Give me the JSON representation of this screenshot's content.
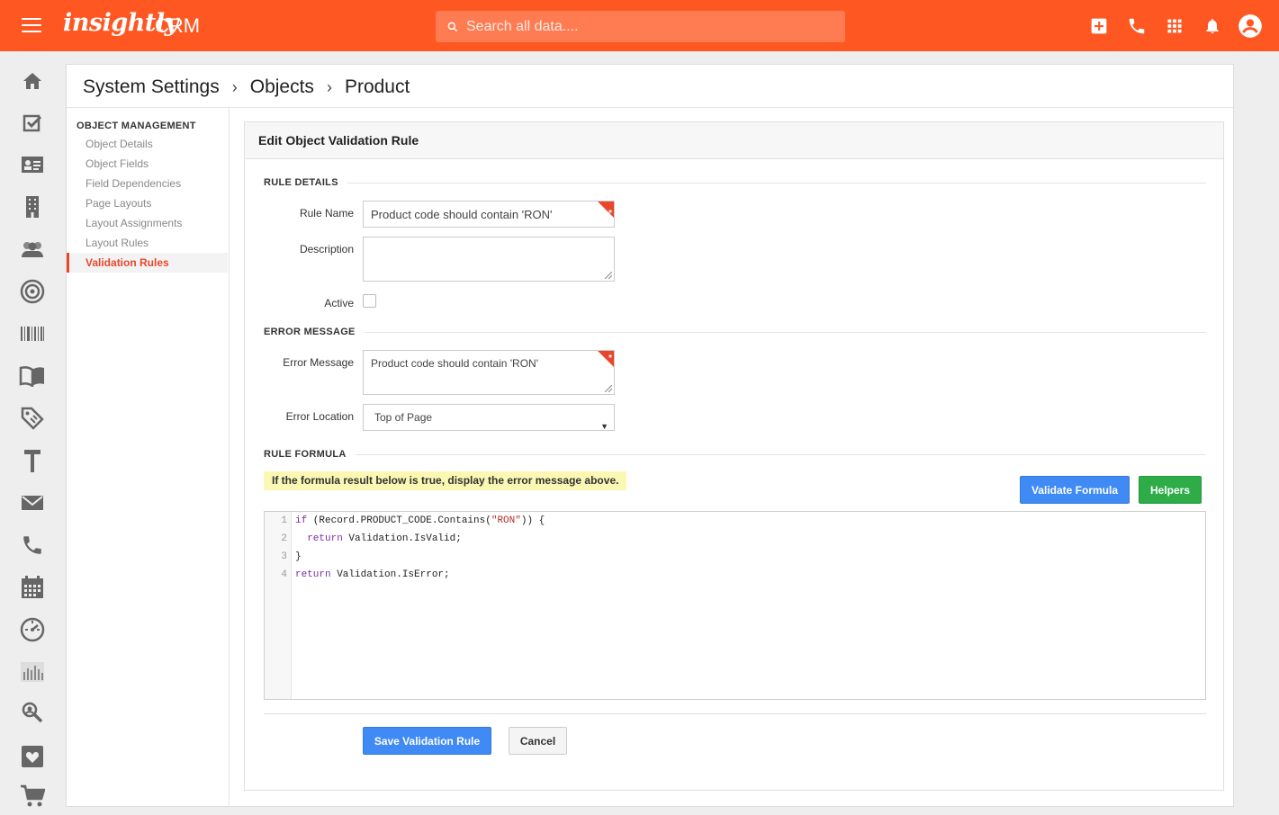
{
  "topbar": {
    "brand": "insightly",
    "brand_suffix": "CRM",
    "search_placeholder": "Search all data....",
    "icons": [
      "add-icon",
      "phone-icon",
      "apps-icon",
      "bell-icon",
      "account-icon"
    ]
  },
  "leftnav": {
    "icons": [
      "home-icon",
      "tasks-icon",
      "contacts-icon",
      "organizations-icon",
      "leads-icon",
      "opportunities-icon",
      "products-icon",
      "knowledge-icon",
      "tags-icon",
      "projects-icon",
      "email-icon",
      "calls-icon",
      "calendar-icon",
      "dashboard-icon",
      "reports-icon",
      "search-people-icon",
      "favorites-icon",
      "cart-icon"
    ]
  },
  "breadcrumb": [
    "System Settings",
    "Objects",
    "Product"
  ],
  "subnav": {
    "heading": "OBJECT MANAGEMENT",
    "items": [
      "Object Details",
      "Object Fields",
      "Field Dependencies",
      "Page Layouts",
      "Layout Assignments",
      "Layout Rules",
      "Validation Rules"
    ],
    "active_index": 6
  },
  "card": {
    "title": "Edit Object Validation Rule",
    "rule_details": {
      "section": "RULE DETAILS",
      "rule_name_label": "Rule Name",
      "rule_name_value": "Product code should contain 'RON'",
      "description_label": "Description",
      "description_value": "",
      "active_label": "Active",
      "active_checked": false
    },
    "error_message": {
      "section": "ERROR MESSAGE",
      "error_message_label": "Error Message",
      "error_message_value": "Product code should contain 'RON'",
      "error_location_label": "Error Location",
      "error_location_value": "Top of Page"
    },
    "rule_formula": {
      "section": "RULE FORMULA",
      "hint": "If the formula result below is true, display the error message above.",
      "validate_label": "Validate Formula",
      "helpers_label": "Helpers",
      "line_numbers": [
        "1",
        "2",
        "3",
        "4"
      ],
      "code": {
        "l1_kw": "if",
        "l1_a": " (Record.PRODUCT_CODE.Contains(",
        "l1_str": "\"RON\"",
        "l1_b": ")) {",
        "l2_kw": "  return",
        "l2_a": " Validation.IsValid;",
        "l3": "}",
        "l4_kw": "return",
        "l4_a": " Validation.IsError;"
      }
    },
    "save_label": "Save Validation Rule",
    "cancel_label": "Cancel"
  },
  "colors": {
    "brand": "#ff5722",
    "accent_red": "#e8472a",
    "button_blue": "#3f8af5",
    "button_green": "#2eac48",
    "hint_yellow": "#fbf8b3"
  }
}
